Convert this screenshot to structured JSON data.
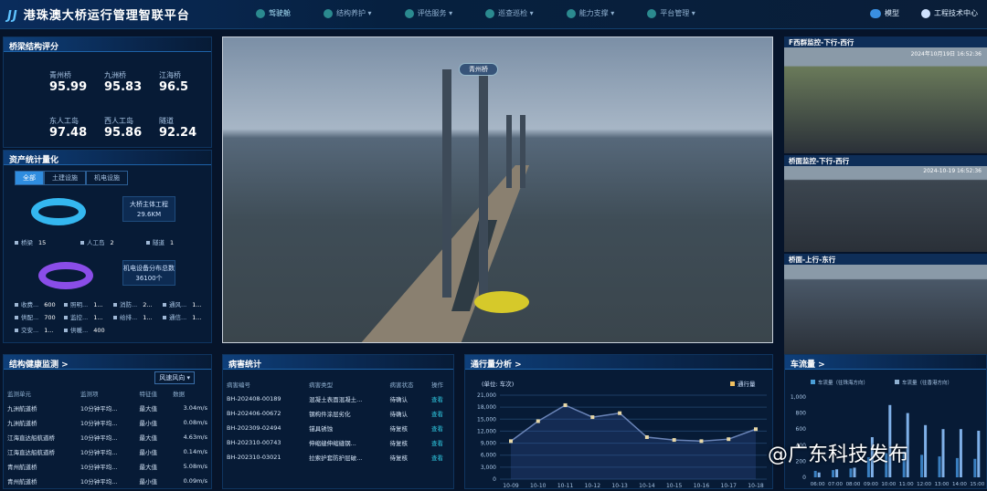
{
  "header": {
    "title": "港珠澳大桥运行管理智联平台",
    "nav": [
      "驾驶舱",
      "结构养护",
      "评估服务",
      "巡查巡检",
      "能力支撑",
      "平台管理"
    ],
    "model": "模型",
    "user": "工程技术中心"
  },
  "scores": {
    "title": "桥梁结构评分",
    "items": [
      {
        "label": "青州桥",
        "value": "95.99"
      },
      {
        "label": "九洲桥",
        "value": "95.83"
      },
      {
        "label": "江海桥",
        "value": "96.5"
      },
      {
        "label": "东人工岛",
        "value": "97.48"
      },
      {
        "label": "西人工岛",
        "value": "95.86"
      },
      {
        "label": "隧道",
        "value": "92.24"
      }
    ]
  },
  "assets": {
    "title": "资产统计量化",
    "tabs": [
      "全部",
      "土建设施",
      "机电设施"
    ],
    "box1": {
      "label": "大桥主体工程",
      "value": "29.6KM"
    },
    "legend1": [
      {
        "k": "桥梁",
        "v": "15"
      },
      {
        "k": "人工岛",
        "v": "2"
      },
      {
        "k": "隧道",
        "v": "1"
      }
    ],
    "box2": {
      "label": "机电设备分布总数",
      "value": "36100个"
    },
    "legend2": [
      {
        "k": "收费...",
        "v": "600"
      },
      {
        "k": "照明...",
        "v": "1..."
      },
      {
        "k": "消防...",
        "v": "2..."
      },
      {
        "k": "通风...",
        "v": "1..."
      },
      {
        "k": "供配...",
        "v": "700"
      },
      {
        "k": "监控...",
        "v": "1..."
      },
      {
        "k": "给排...",
        "v": "1..."
      },
      {
        "k": "通信...",
        "v": "1..."
      },
      {
        "k": "交安...",
        "v": "1..."
      },
      {
        "k": "供暖...",
        "v": "400"
      }
    ]
  },
  "health": {
    "title": "结构健康监测",
    "select": "风速风向",
    "columns": [
      "监测单元",
      "监测项",
      "特征值",
      "数据"
    ],
    "rows": [
      [
        "九洲航道桥",
        "10分钟平均...",
        "最大值",
        "3.04m/s"
      ],
      [
        "九洲航道桥",
        "10分钟平均...",
        "最小值",
        "0.08m/s"
      ],
      [
        "江海直达船航道桥",
        "10分钟平均...",
        "最大值",
        "4.63m/s"
      ],
      [
        "江海直达船航道桥",
        "10分钟平均...",
        "最小值",
        "0.14m/s"
      ],
      [
        "青州航道桥",
        "10分钟平均...",
        "最大值",
        "5.08m/s"
      ],
      [
        "青州航道桥",
        "10分钟平均...",
        "最小值",
        "0.09m/s"
      ]
    ]
  },
  "disease": {
    "title": "病害统计",
    "columns": [
      "病害编号",
      "病害类型",
      "病害状态",
      "操作"
    ],
    "rows": [
      [
        "BH-202408-00189",
        "混凝土表面混凝土...",
        "待确认",
        "查看"
      ],
      [
        "BH-202406-00672",
        "钢构件涂层劣化",
        "待确认",
        "查看"
      ],
      [
        "BH-202309-02494",
        "锚具锈蚀",
        "待复核",
        "查看"
      ],
      [
        "BH-202310-00743",
        "伸缩缝伸缩缝钢...",
        "待复核",
        "查看"
      ],
      [
        "BH-202310-03021",
        "拉索护套防护层破...",
        "待复核",
        "查看"
      ]
    ]
  },
  "video": {
    "label": "青州桥"
  },
  "cams": [
    {
      "title": "F西群监控-下行-西行",
      "stamp": "2024年10月19日 16:52:36"
    },
    {
      "title": "桥面监控-下行-西行",
      "stamp": "2024-10-19 16:52:36"
    },
    {
      "title": "桥面-上行-东行",
      "stamp": ""
    }
  ],
  "chart_data": [
    {
      "type": "line",
      "title": "通行量分析",
      "unit": "(单位: 车次)",
      "legend": "通行量",
      "categories": [
        "10-09",
        "10-10",
        "10-11",
        "10-12",
        "10-13",
        "10-14",
        "10-15",
        "10-16",
        "10-17",
        "10-18"
      ],
      "values": [
        9500,
        14500,
        18500,
        15500,
        16500,
        10500,
        9800,
        9500,
        10000,
        12500
      ],
      "ylim": [
        0,
        21000
      ],
      "yticks": [
        "0",
        "3,000",
        "6,000",
        "9,000",
        "12,000",
        "15,000",
        "18,000",
        "21,000"
      ]
    },
    {
      "type": "bar",
      "title": "车流量",
      "categories": [
        "06:00",
        "07:00",
        "08:00",
        "09:00",
        "10:00",
        "11:00",
        "12:00",
        "13:00",
        "14:00",
        "15:00"
      ],
      "series": [
        {
          "name": "车流量（往珠海方向）",
          "values": [
            80,
            90,
            110,
            250,
            300,
            320,
            280,
            260,
            240,
            230
          ]
        },
        {
          "name": "车流量（往香港方向）",
          "values": [
            60,
            100,
            120,
            500,
            900,
            800,
            650,
            600,
            600,
            580
          ]
        }
      ],
      "ylim": [
        0,
        1000
      ],
      "yticks": [
        "0",
        "200",
        "400",
        "600",
        "800",
        "1,000"
      ]
    }
  ],
  "watermark": "@广东科技发布"
}
